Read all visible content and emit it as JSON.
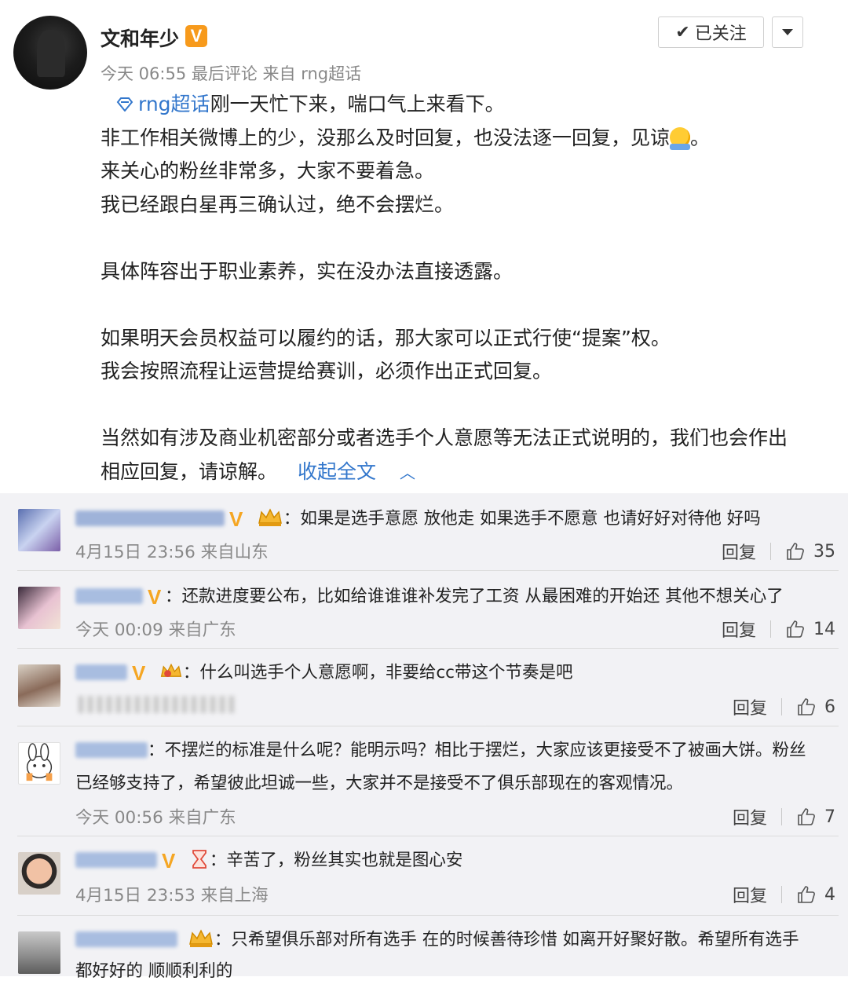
{
  "post": {
    "username": "文和年少",
    "verified_badge": "V",
    "meta": "今天 06:55 最后评论 来自 rng超话",
    "follow_button": "已关注",
    "topic_link": "rng超话",
    "lines": [
      "刚一天忙下来，喘口气上来看下。",
      "非工作相关微博上的少，没那么及时回复，也没法逐一回复，见谅",
      "来关心的粉丝非常多，大家不要着急。",
      "我已经跟白星再三确认过，绝不会摆烂。",
      "具体阵容出于职业素养，实在没办法直接透露。",
      "如果明天会员权益可以履约的话，那大家可以正式行使“提案”权。",
      "我会按照流程让运营提给赛训，必须作出正式回复。",
      "当然如有涉及商业机密部分或者选手个人意愿等无法正式说明的，我们也会作出",
      "相应回复，请谅解。"
    ],
    "line2_end": "。",
    "collapse_link": "收起全文"
  },
  "comments": [
    {
      "text": "如果是选手意愿 放他走 如果选手不愿意 也请好好对待他 好吗",
      "meta": "4月15日 23:56 来自山东",
      "reply": "回复",
      "likes": "35"
    },
    {
      "text": "还款进度要公布，比如给谁谁谁补发完了工资 从最困难的开始还 其他不想关心了",
      "meta": "今天 00:09 来自广东",
      "reply": "回复",
      "likes": "14"
    },
    {
      "text": "什么叫选手个人意愿啊，非要给cc带这个节奏是吧",
      "meta": "",
      "reply": "回复",
      "likes": "6"
    },
    {
      "text": "不摆烂的标准是什么呢？能明示吗？相比于摆烂，大家应该更接受不了被画大饼。粉丝",
      "text2": "已经够支持了，希望彼此坦诚一些，大家并不是接受不了俱乐部现在的客观情况。",
      "meta": "今天 00:56 来自广东",
      "reply": "回复",
      "likes": "7"
    },
    {
      "text": "辛苦了，粉丝其实也就是图心安",
      "meta": "4月15日 23:53 来自上海",
      "reply": "回复",
      "likes": "4"
    },
    {
      "text": "只希望俱乐部对所有选手 在的时候善待珍惜 如离开好聚好散。希望所有选手",
      "text2": "都好好的 顺顺利利的"
    }
  ],
  "colors": {
    "link": "#3377cc",
    "verified_orange": "#f79a1c",
    "v_gold": "#f5a623",
    "comment_bg": "#f2f2f5"
  }
}
